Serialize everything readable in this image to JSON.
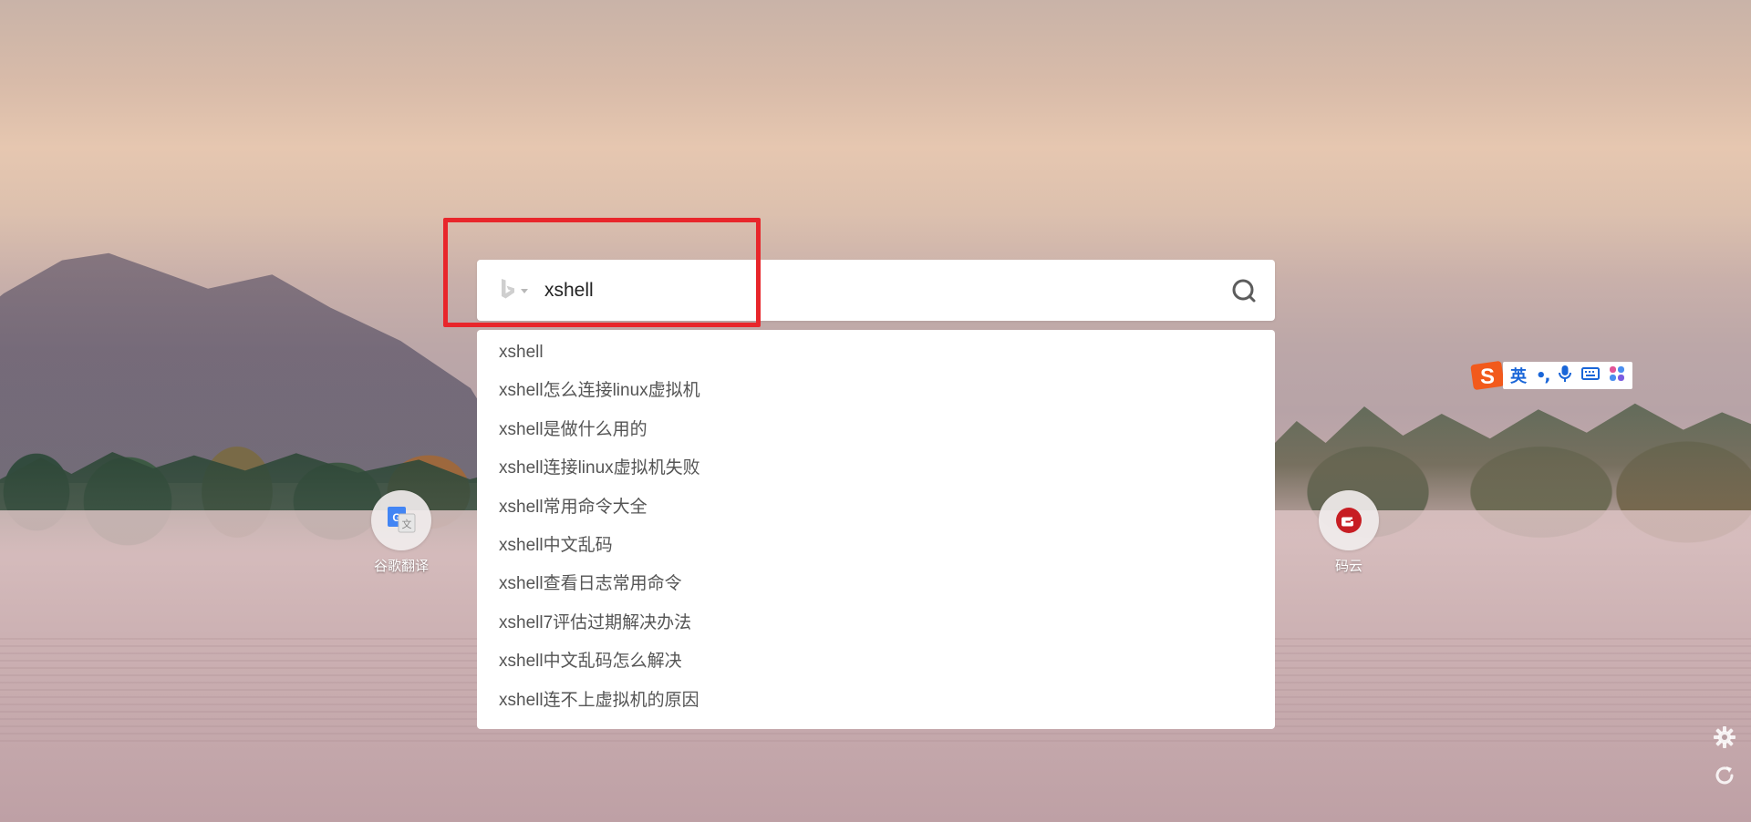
{
  "search": {
    "engine_icon": "bing-icon",
    "query": "xshell",
    "submit_icon": "search-icon"
  },
  "suggestions": [
    "xshell",
    "xshell怎么连接linux虚拟机",
    "xshell是做什么用的",
    "xshell连接linux虚拟机失败",
    "xshell常用命令大全",
    "xshell中文乱码",
    "xshell查看日志常用命令",
    "xshell7评估过期解决办法",
    "xshell中文乱码怎么解决",
    "xshell连不上虚拟机的原因"
  ],
  "shortcuts": {
    "left": {
      "label": "谷歌翻译",
      "icon": "google-translate-icon"
    },
    "right": {
      "label": "码云",
      "icon": "gitee-icon"
    }
  },
  "ime": {
    "logo_icon": "sogou-logo-icon",
    "mode": "英",
    "punct": "•,",
    "icons": [
      "microphone-icon",
      "keyboard-icon",
      "apps-icon"
    ]
  },
  "side_tools": {
    "settings_icon": "gear-icon",
    "refresh_icon": "refresh-icon"
  },
  "colors": {
    "highlight": "#e8262b",
    "ime_blue": "#1a66d8",
    "sogou_orange": "#f25a1c",
    "gitee_red": "#c71d23"
  }
}
